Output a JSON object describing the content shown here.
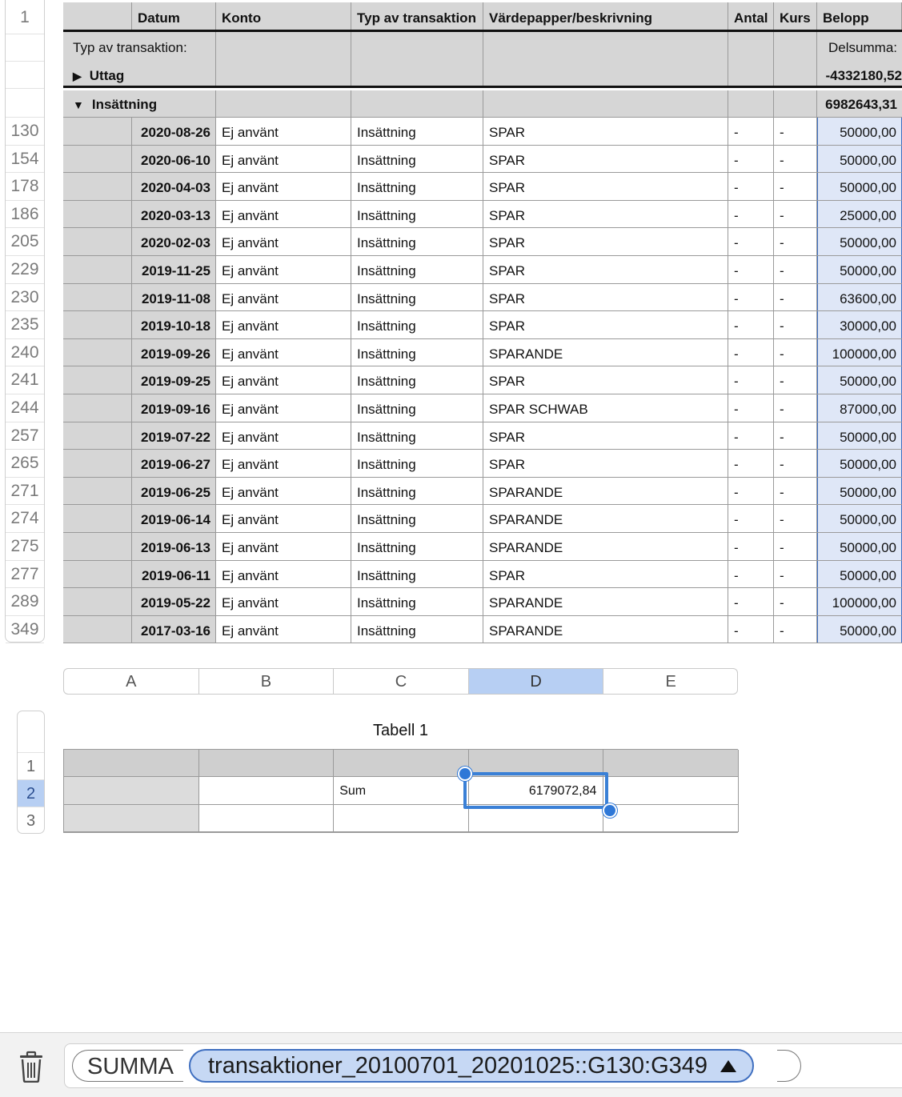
{
  "gutter": {
    "header_row": "1",
    "data_rows": [
      "130",
      "154",
      "178",
      "186",
      "205",
      "229",
      "230",
      "235",
      "240",
      "241",
      "244",
      "257",
      "265",
      "271",
      "274",
      "275",
      "277",
      "289",
      "349"
    ]
  },
  "main": {
    "headers": [
      "",
      "Datum",
      "Konto",
      "Typ av transaktion",
      "Värdepapper/beskrivning",
      "Antal",
      "Kurs",
      "Belopp"
    ],
    "category_label": "Typ av transaktion:",
    "subtotal_label": "Delsumma:",
    "groups": [
      {
        "arrow": "▶",
        "label": "Uttag",
        "total": "-4332180,52"
      },
      {
        "arrow": "▼",
        "label": "Insättning",
        "total": "6982643,31"
      }
    ],
    "rows": [
      {
        "datum": "2020-08-26",
        "konto": "Ej använt",
        "typ": "Insättning",
        "desc": "SPAR",
        "antal": "-",
        "kurs": "-",
        "belopp": "50000,00"
      },
      {
        "datum": "2020-06-10",
        "konto": "Ej använt",
        "typ": "Insättning",
        "desc": "SPAR",
        "antal": "-",
        "kurs": "-",
        "belopp": "50000,00"
      },
      {
        "datum": "2020-04-03",
        "konto": "Ej använt",
        "typ": "Insättning",
        "desc": "SPAR",
        "antal": "-",
        "kurs": "-",
        "belopp": "50000,00"
      },
      {
        "datum": "2020-03-13",
        "konto": "Ej använt",
        "typ": "Insättning",
        "desc": "SPAR",
        "antal": "-",
        "kurs": "-",
        "belopp": "25000,00"
      },
      {
        "datum": "2020-02-03",
        "konto": "Ej använt",
        "typ": "Insättning",
        "desc": "SPAR",
        "antal": "-",
        "kurs": "-",
        "belopp": "50000,00"
      },
      {
        "datum": "2019-11-25",
        "konto": "Ej använt",
        "typ": "Insättning",
        "desc": "SPAR",
        "antal": "-",
        "kurs": "-",
        "belopp": "50000,00"
      },
      {
        "datum": "2019-11-08",
        "konto": "Ej använt",
        "typ": "Insättning",
        "desc": "SPAR",
        "antal": "-",
        "kurs": "-",
        "belopp": "63600,00"
      },
      {
        "datum": "2019-10-18",
        "konto": "Ej använt",
        "typ": "Insättning",
        "desc": "SPAR",
        "antal": "-",
        "kurs": "-",
        "belopp": "30000,00"
      },
      {
        "datum": "2019-09-26",
        "konto": "Ej använt",
        "typ": "Insättning",
        "desc": "SPARANDE",
        "antal": "-",
        "kurs": "-",
        "belopp": "100000,00"
      },
      {
        "datum": "2019-09-25",
        "konto": "Ej använt",
        "typ": "Insättning",
        "desc": "SPAR",
        "antal": "-",
        "kurs": "-",
        "belopp": "50000,00"
      },
      {
        "datum": "2019-09-16",
        "konto": "Ej använt",
        "typ": "Insättning",
        "desc": "SPAR SCHWAB",
        "antal": "-",
        "kurs": "-",
        "belopp": "87000,00"
      },
      {
        "datum": "2019-07-22",
        "konto": "Ej använt",
        "typ": "Insättning",
        "desc": "SPAR",
        "antal": "-",
        "kurs": "-",
        "belopp": "50000,00"
      },
      {
        "datum": "2019-06-27",
        "konto": "Ej använt",
        "typ": "Insättning",
        "desc": "SPAR",
        "antal": "-",
        "kurs": "-",
        "belopp": "50000,00"
      },
      {
        "datum": "2019-06-25",
        "konto": "Ej använt",
        "typ": "Insättning",
        "desc": "SPARANDE",
        "antal": "-",
        "kurs": "-",
        "belopp": "50000,00"
      },
      {
        "datum": "2019-06-14",
        "konto": "Ej använt",
        "typ": "Insättning",
        "desc": "SPARANDE",
        "antal": "-",
        "kurs": "-",
        "belopp": "50000,00"
      },
      {
        "datum": "2019-06-13",
        "konto": "Ej använt",
        "typ": "Insättning",
        "desc": "SPARANDE",
        "antal": "-",
        "kurs": "-",
        "belopp": "50000,00"
      },
      {
        "datum": "2019-06-11",
        "konto": "Ej använt",
        "typ": "Insättning",
        "desc": "SPAR",
        "antal": "-",
        "kurs": "-",
        "belopp": "50000,00"
      },
      {
        "datum": "2019-05-22",
        "konto": "Ej använt",
        "typ": "Insättning",
        "desc": "SPARANDE",
        "antal": "-",
        "kurs": "-",
        "belopp": "100000,00"
      },
      {
        "datum": "2017-03-16",
        "konto": "Ej använt",
        "typ": "Insättning",
        "desc": "SPARANDE",
        "antal": "-",
        "kurs": "-",
        "belopp": "50000,00"
      }
    ]
  },
  "table1": {
    "title": "Tabell 1",
    "column_letters": [
      "A",
      "B",
      "C",
      "D",
      "E"
    ],
    "active_column": "D",
    "row_numbers": [
      "1",
      "2",
      "3"
    ],
    "active_row": "2",
    "sum_label": "Sum",
    "sum_value": "6179072,84"
  },
  "formula": {
    "function": "SUMMA",
    "reference": "transaktioner_20100701_20201025::G130:G349",
    "trash_icon": "trash-icon",
    "accent_color": "#3a80d6"
  }
}
